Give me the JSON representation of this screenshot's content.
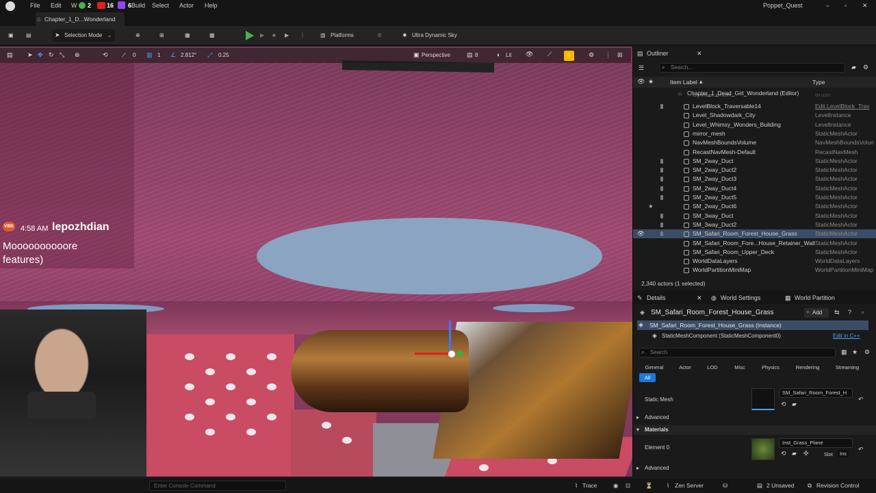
{
  "menubar": {
    "items": [
      "File",
      "Edit",
      "W",
      "Build",
      "Select",
      "Actor",
      "Help"
    ],
    "badge_green": "2",
    "badge_red": "16",
    "badge_purple": "6",
    "project": "Poppet_Quest"
  },
  "level_tab": {
    "label": "Chapter_1_D...Wonderland"
  },
  "toolbar": {
    "selection_mode": "Selection Mode",
    "platforms": "Platforms",
    "sky": "Ultra Dynamic Sky"
  },
  "viewport_toolbar": {
    "rot_snap": "0",
    "grid_snap": "1",
    "scale_snap": "2.812°",
    "camera_speed": "0.25",
    "view": "Perspective",
    "fov": "8",
    "lit": "Lit"
  },
  "chat": {
    "time": "4:58 AM",
    "user": "lepozhdian",
    "badge": "VIBE",
    "message_line1": "Moooooooooore",
    "message_line2": "features)"
  },
  "outliner": {
    "tab": "Outliner",
    "search_placeholder": "Search...",
    "col_label": "Item Label",
    "col_type": "Type",
    "root": "Chapter_1_Dead_Girl_Wonderland (Editor)",
    "clipped_row": "Cylinder Brush",
    "clipped_type": "Brush",
    "rows": [
      {
        "label": "LevelBlock_Traversable14",
        "type": "Edit LevelBlock_Trav"
      },
      {
        "label": "Level_Shadowdark_City",
        "type": "LevelInstance"
      },
      {
        "label": "Level_Whimsy_Wonders_Building",
        "type": "LevelInstance"
      },
      {
        "label": "mirror_mesh",
        "type": "StaticMeshActor"
      },
      {
        "label": "NavMeshBoundsVolume",
        "type": "NavMeshBoundsVolume"
      },
      {
        "label": "RecastNavMesh-Default",
        "type": "RecastNavMesh"
      },
      {
        "label": "SM_2way_Duct",
        "type": "StaticMeshActor"
      },
      {
        "label": "SM_2way_Duct2",
        "type": "StaticMeshActor"
      },
      {
        "label": "SM_2way_Duct3",
        "type": "StaticMeshActor"
      },
      {
        "label": "SM_2way_Duct4",
        "type": "StaticMeshActor"
      },
      {
        "label": "SM_2way_Duct5",
        "type": "StaticMeshActor"
      },
      {
        "label": "SM_2way_Duct6",
        "type": "StaticMeshActor"
      },
      {
        "label": "SM_3way_Duct",
        "type": "StaticMeshActor"
      },
      {
        "label": "SM_3way_Duct2",
        "type": "StaticMeshActor"
      },
      {
        "label": "SM_Safari_Room_Forest_House_Grass",
        "type": "StaticMeshActor"
      },
      {
        "label": "SM_Safari_Room_Fore...House_Retainer_Wall",
        "type": "StaticMeshActor"
      },
      {
        "label": "SM_Safari_Room_Upper_Deck",
        "type": "StaticMeshActor"
      },
      {
        "label": "WorldDataLayers",
        "type": "WorldDataLayers"
      },
      {
        "label": "WorldPartitionMiniMap",
        "type": "WorldPartitionMiniMap"
      }
    ],
    "footer": "2,340 actors (1 selected)"
  },
  "details": {
    "tab": "Details",
    "tab_world_settings": "World Settings",
    "tab_world_partition": "World Partition",
    "object_name": "SM_Safari_Room_Forest_House_Grass",
    "add_label": "Add",
    "instance": "SM_Safari_Room_Forest_House_Grass (Instance)",
    "component": "StaticMeshComponent (StaticMeshComponent0)",
    "edit_cpp": "Edit in C++",
    "search_placeholder": "Search",
    "categories": [
      "General",
      "Actor",
      "LOD",
      "Misc",
      "Physics",
      "Rendering",
      "Streaming"
    ],
    "all": "All",
    "static_mesh_label": "Static Mesh",
    "static_mesh_value": "SM_Safari_Room_Forest_H",
    "advanced": "Advanced",
    "materials": "Materials",
    "element0": "Element 0",
    "material_value": "Inst_Grass_Plane",
    "slot": "Slot",
    "ins": "Ins",
    "advanced2": "Advanced"
  },
  "statusbar": {
    "console_placeholder": "Enter Console Command",
    "trace": "Trace",
    "zen": "Zen Server",
    "unsaved": "2 Unsaved",
    "revision": "Revision Control"
  },
  "colors": {
    "selection": "#3a4d66",
    "accent_link": "#4aa3ff",
    "play_green": "#4caf50",
    "wall_pink": "#c94c64"
  }
}
